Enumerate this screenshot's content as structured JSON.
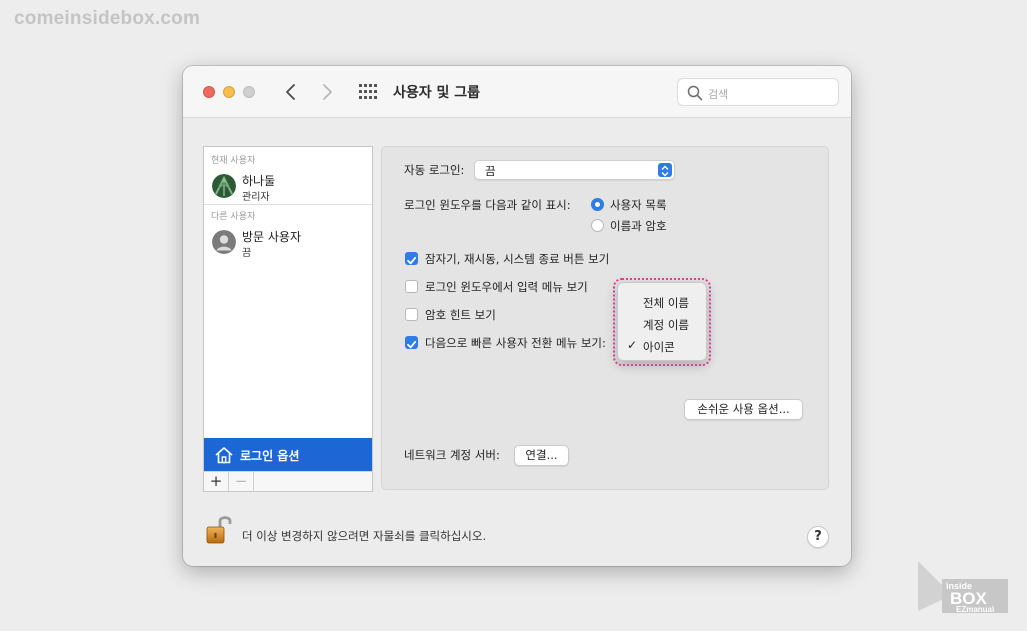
{
  "watermark": "comeinsidebox.com",
  "window": {
    "title": "사용자 및 그룹",
    "search_placeholder": "검색"
  },
  "users": {
    "current_label": "현재 사용자",
    "current": {
      "name": "하나둘",
      "role": "관리자"
    },
    "other_label": "다른 사용자",
    "other": {
      "name": "방문 사용자",
      "role": "끔"
    },
    "login_options": "로그인 옵션",
    "add": "+",
    "remove": "−"
  },
  "panel": {
    "auto_login_label": "자동 로그인:",
    "auto_login_value": "끔",
    "display_label": "로그인 윈도우를 다음과 같이 표시:",
    "radio_list": "사용자 목록",
    "radio_name_password": "이름과 암호",
    "chk_sleep": "잠자기, 재시동, 시스템 종료 버튼 보기",
    "chk_input_menu": "로그인 윈도우에서 입력 메뉴 보기",
    "chk_password_hint": "암호 힌트 보기",
    "chk_fast_switch": "다음으로 빠른 사용자 전환 메뉴 보기:",
    "accessibility_button": "손쉬운 사용 옵션...",
    "network_label": "네트워크 계정 서버:",
    "connect_button": "연결..."
  },
  "dropdown": {
    "items": [
      "전체 이름",
      "계정 이름",
      "아이콘"
    ],
    "selected": "아이콘",
    "checkmark": "✓"
  },
  "footer": {
    "lock_text": "더 이상 변경하지 않으려면 자물쇠를 클릭하십시오.",
    "help": "?"
  },
  "logo": {
    "line1": "inside",
    "line2": "BOX",
    "line3": "EZmanual"
  },
  "colors": {
    "accent": "#2f7ce6",
    "selection": "#1d66d6",
    "highlight": "#e23c8e"
  }
}
